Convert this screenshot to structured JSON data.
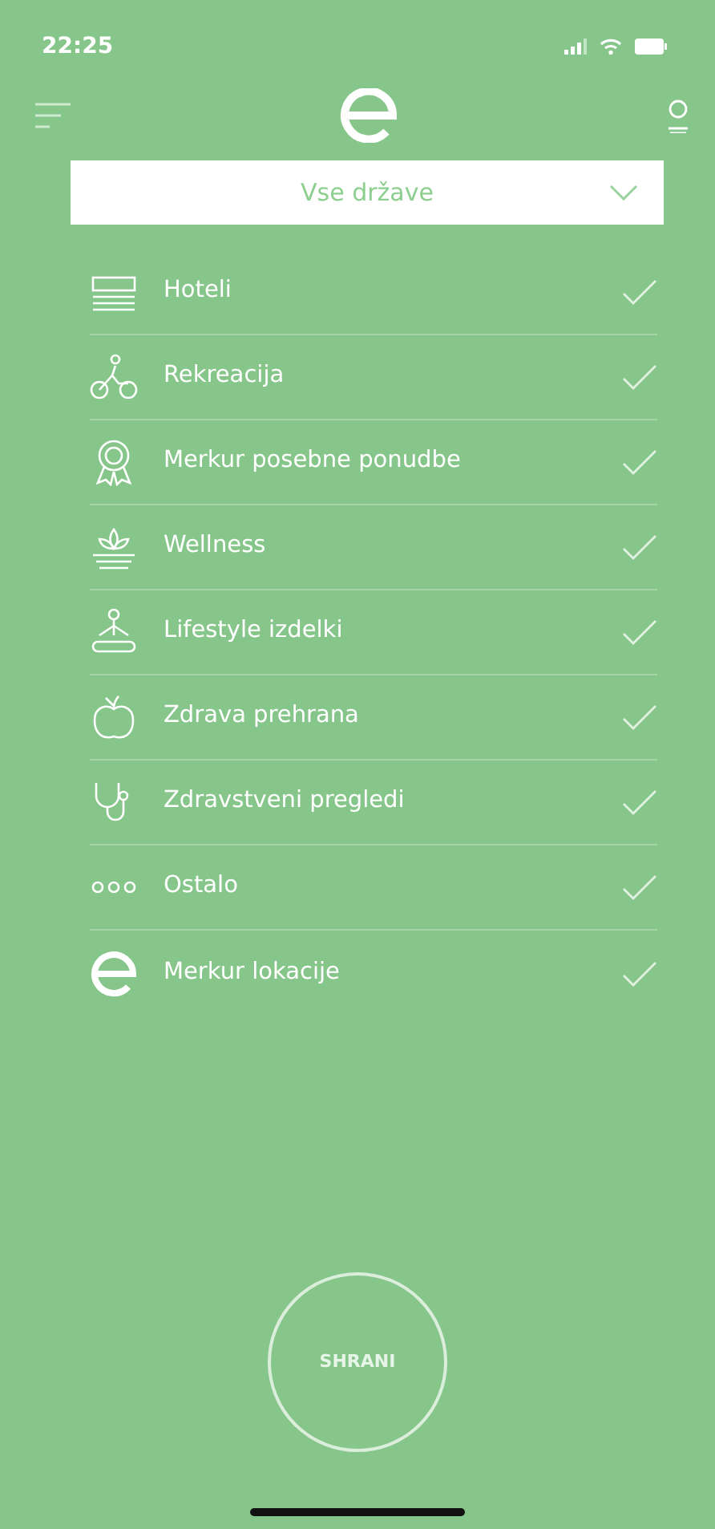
{
  "status_bar": {
    "time": "22:25"
  },
  "dropdown": {
    "value": "Vse države"
  },
  "categories": [
    {
      "label": "Hoteli",
      "checked": true
    },
    {
      "label": "Rekreacija",
      "checked": true
    },
    {
      "label": "Merkur posebne ponudbe",
      "checked": true
    },
    {
      "label": "Wellness",
      "checked": true
    },
    {
      "label": "Lifestyle izdelki",
      "checked": true
    },
    {
      "label": "Zdrava prehrana",
      "checked": true
    },
    {
      "label": "Zdravstveni pregledi",
      "checked": true
    },
    {
      "label": "Ostalo",
      "checked": true
    },
    {
      "label": "Merkur lokacije",
      "checked": true
    }
  ],
  "save_button": "SHRANI"
}
